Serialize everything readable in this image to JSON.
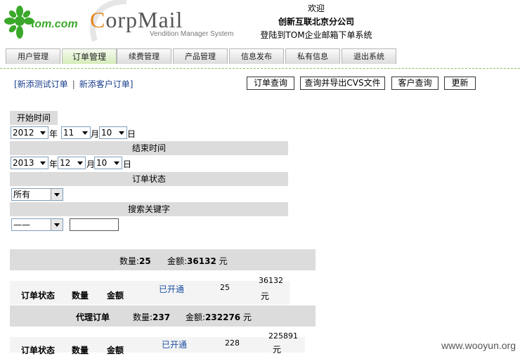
{
  "header": {
    "logo_text": "tom.com",
    "brand_title_first": "C",
    "brand_title_rest": "orpMail",
    "brand_subtitle": "Vendition Manager System",
    "welcome": "欢迎",
    "company": "创新互联北京分公司",
    "system_name": "登陆到TOM企业邮箱下单系统"
  },
  "tabs": [
    {
      "label": "用户管理"
    },
    {
      "label": "订单管理"
    },
    {
      "label": "续费管理"
    },
    {
      "label": "产品管理"
    },
    {
      "label": "信息发布"
    },
    {
      "label": "私有信息"
    },
    {
      "label": "退出系统"
    }
  ],
  "actions": {
    "link_test_order": "[新添测试订单",
    "link_separator": "|",
    "link_customer_order": "新添客户订单]",
    "btn_order_query": "订单查询",
    "btn_query_export": "查询并导出CVS文件",
    "btn_customer_query": "客户查询",
    "btn_refresh": "更新"
  },
  "filters": {
    "start_label": "开始时间",
    "start_year": "2012",
    "start_month": "11",
    "start_day": "10",
    "end_label": "结束时间",
    "end_year": "2013",
    "end_month": "12",
    "end_day": "10",
    "unit_year": "年",
    "unit_month": "月",
    "unit_day": "日",
    "status_label": "订单状态",
    "status_value": "所有",
    "keyword_label": "搜索关键字",
    "keyword_select": "——",
    "keyword_value": ""
  },
  "summary1": {
    "count_label": "数量:",
    "count": "25",
    "amount_label": "金额:",
    "amount": "36132",
    "currency": "元"
  },
  "table1": {
    "col_status": "订单状态",
    "col_count": "数量",
    "col_amount": "金额",
    "row_status": "已开通",
    "row_count": "25",
    "row_amount": "36132",
    "row_currency": "元"
  },
  "summary2": {
    "title": "代理订单",
    "count_label": "数量:",
    "count": "237",
    "amount_label": "金额:",
    "amount": "232276",
    "currency": "元"
  },
  "table2": {
    "col_status": "订单状态",
    "col_count": "数量",
    "col_amount": "金额",
    "row_status": "已开通",
    "row_count": "228",
    "row_amount": "225891",
    "row_currency": "元"
  },
  "watermark": "www.wooyun.org",
  "colors": {
    "tom_green": "#3aa82a",
    "link_blue": "#1a3e8c",
    "bar_gray": "#dcdcdc",
    "active_tab": "#d4ecb9"
  }
}
